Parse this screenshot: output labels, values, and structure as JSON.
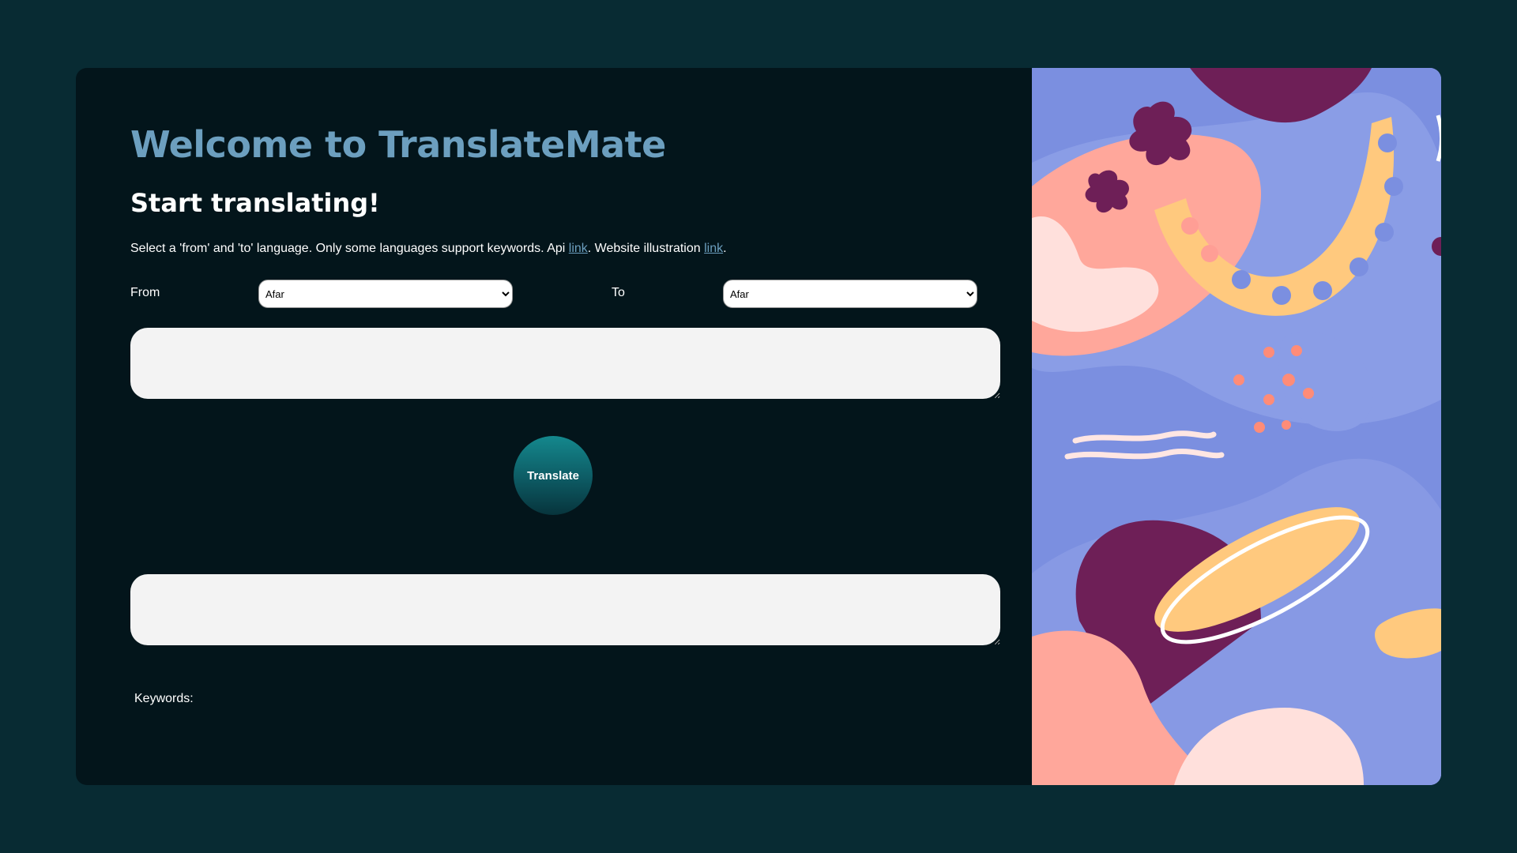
{
  "header": {
    "title": "Welcome to TranslateMate",
    "subtitle": "Start translating!"
  },
  "description": {
    "text_before": "Select a 'from' and 'to' language. Only some languages support keywords. Api ",
    "api_link": "link",
    "text_middle": ". Website illustration ",
    "illustration_link": "link",
    "text_after": "."
  },
  "languages": {
    "from_label": "From",
    "from_value": "Afar",
    "to_label": "To",
    "to_value": "Afar"
  },
  "input": {
    "value": "",
    "placeholder": ""
  },
  "output": {
    "value": "",
    "placeholder": ""
  },
  "actions": {
    "translate_label": "Translate"
  },
  "keywords": {
    "label": "Keywords:"
  },
  "colors": {
    "page_background": "#082b33",
    "card_background": "#03151b",
    "title_accent": "#6c9fbf",
    "button_teal": "#14888d",
    "illustration_blue": "#7b8fe0"
  }
}
